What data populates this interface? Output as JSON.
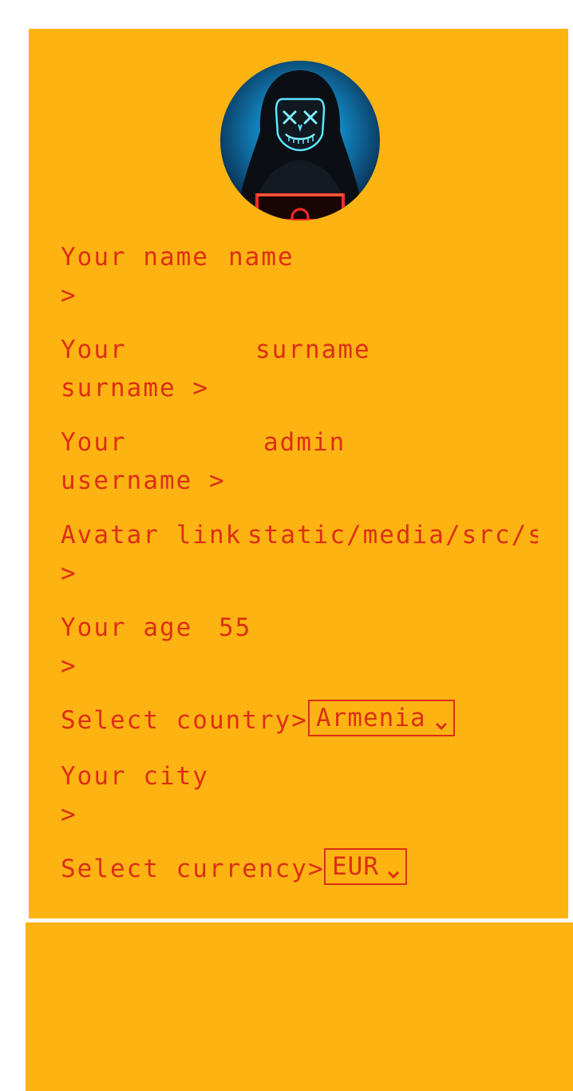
{
  "profile": {
    "avatar_alt": "avatar",
    "fields": [
      {
        "label": "Your name",
        "value": "name",
        "arrow": ">"
      },
      {
        "label": "Your",
        "label2": "surname",
        "value": "surname",
        "arrow": ">"
      },
      {
        "label": "Your",
        "label2": "username",
        "value": "admin",
        "arrow": ">"
      },
      {
        "label": "Avatar link",
        "value": "static/media/src/sl",
        "arrow": ">"
      },
      {
        "label": "Your age",
        "value": "55",
        "arrow": ">"
      },
      {
        "label": "Your city",
        "value": "",
        "arrow": ">"
      }
    ],
    "country": {
      "label": "Select country>",
      "selected": "Armenia"
    },
    "currency": {
      "label": "Select currency>",
      "selected": "EUR"
    }
  },
  "colors": {
    "panel_bg": "#fdb413",
    "text": "#dc2f12",
    "page_bg": "#ffffff"
  },
  "icons": {
    "select_chevron": "chevron-down-icon"
  }
}
